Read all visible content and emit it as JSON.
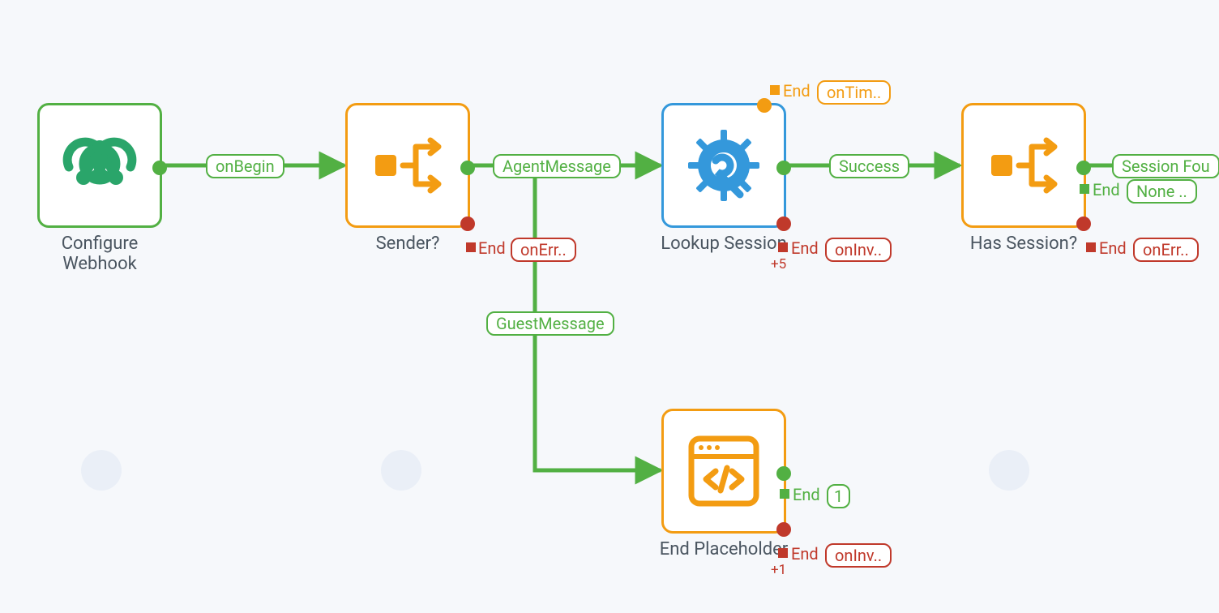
{
  "nodes": {
    "configure_webhook": {
      "label": "Configure\nWebhook"
    },
    "sender": {
      "label": "Sender?"
    },
    "lookup_session": {
      "label": "Lookup Session"
    },
    "has_session": {
      "label": "Has Session?"
    },
    "end_placeholder": {
      "label": "End Placeholder"
    }
  },
  "edges": {
    "onBegin": "onBegin",
    "agentMessage": "AgentMessage",
    "guestMessage": "GuestMessage",
    "success": "Success",
    "sessionFound": "Session Fou"
  },
  "annotations": {
    "end": "End",
    "onErr": "onErr..",
    "onInv": "onInv..",
    "onTim": "onTim..",
    "none": "None ..",
    "one": "1",
    "plus5": "+5",
    "plus1": "+1"
  },
  "colors": {
    "green": "#52b043",
    "orange": "#f39c12",
    "blue": "#3498db",
    "red": "#c0392b"
  }
}
